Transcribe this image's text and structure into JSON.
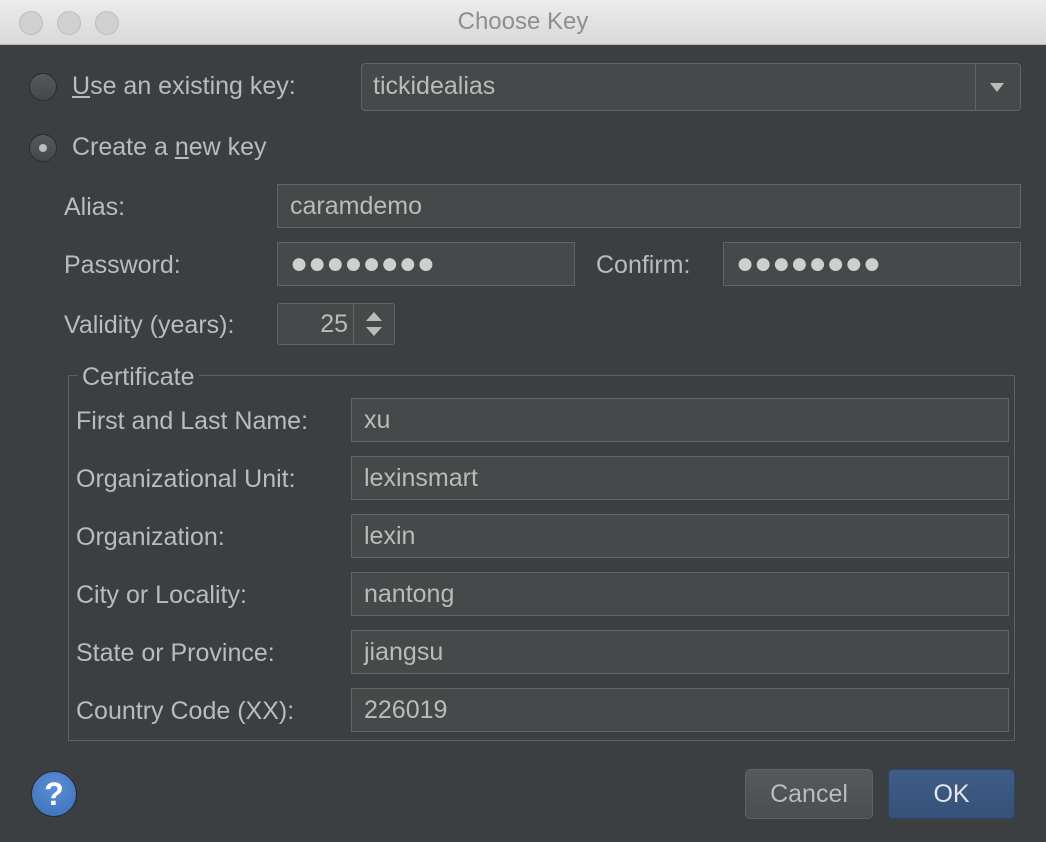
{
  "window": {
    "title": "Choose Key"
  },
  "existing_key": {
    "label_pre": "",
    "label_mnemonic": "U",
    "label_post": "se an existing key:",
    "selected": "tickidealias"
  },
  "new_key": {
    "label_pre": "Create a ",
    "label_mnemonic": "n",
    "label_post": "ew key"
  },
  "fields": {
    "alias_label": "Alias:",
    "alias_value": "caramdemo",
    "password_label": "Password:",
    "password_value": "●●●●●●●●",
    "confirm_label": "Confirm:",
    "confirm_value": "●●●●●●●●",
    "validity_label": "Validity (years):",
    "validity_value": "25"
  },
  "certificate": {
    "legend": "Certificate",
    "rows": [
      {
        "label": "First and Last Name:",
        "value": "xu"
      },
      {
        "label": "Organizational Unit:",
        "value": "lexinsmart"
      },
      {
        "label": "Organization:",
        "value": "lexin"
      },
      {
        "label": "City or Locality:",
        "value": "nantong"
      },
      {
        "label": "State or Province:",
        "value": "jiangsu"
      },
      {
        "label": "Country Code (XX):",
        "value": "226019"
      }
    ]
  },
  "buttons": {
    "help": "?",
    "cancel": "Cancel",
    "ok": "OK"
  },
  "colors": {
    "background": "#3c3f41",
    "field": "#45494a",
    "ok_button": "#3b5a84",
    "help_icon": "#4a80c8"
  }
}
